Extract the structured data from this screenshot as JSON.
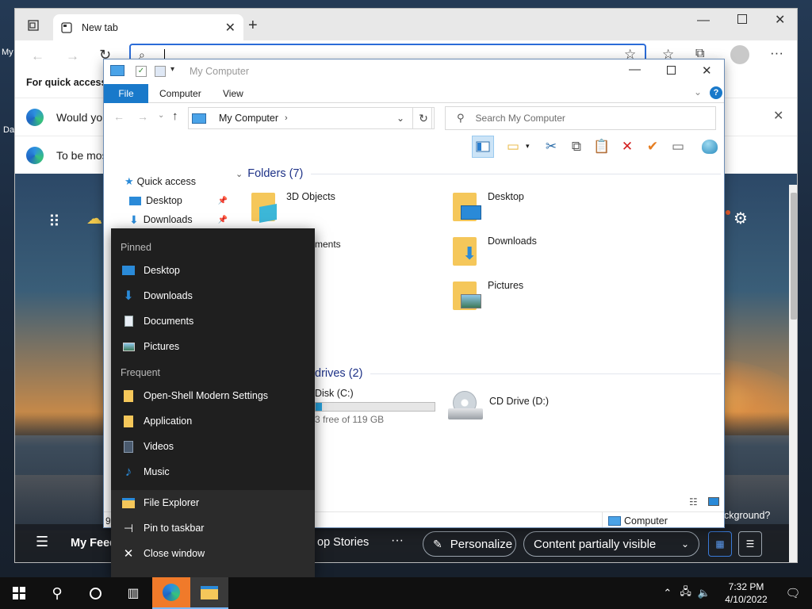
{
  "desktop": {
    "label_my": "My",
    "label_da": "Da"
  },
  "edge": {
    "tab_title": "New tab",
    "quick_access_prefix": "For quick access, p",
    "msg1": "Would you",
    "msg2": "To be mos",
    "news": {
      "my_feed": "My Feed",
      "top_stories": "op Stories",
      "more": "···",
      "personalize": "Personalize",
      "content_visibility": "Content partially visible",
      "background_q": "ckground?"
    }
  },
  "explorer": {
    "title": "My Computer",
    "tabs": {
      "file": "File",
      "computer": "Computer",
      "view": "View"
    },
    "breadcrumb": "My Computer",
    "search_placeholder": "Search My Computer",
    "nav": {
      "quick_access": "Quick access",
      "desktop": "Desktop",
      "downloads": "Downloads"
    },
    "folders_header": "Folders (7)",
    "folders": [
      "3D Objects",
      "Desktop",
      "Downloads",
      "Pictures"
    ],
    "partial_documents": "ments",
    "drives_header": "drives (2)",
    "drive_c": {
      "name": "Disk (C:)",
      "free": "3 free of 119 GB",
      "used_fraction": 0.05
    },
    "drive_d": {
      "name": "CD Drive (D:)"
    },
    "status_items": "9",
    "status_location": "Computer"
  },
  "jumplist": {
    "pinned_label": "Pinned",
    "pinned": [
      "Desktop",
      "Downloads",
      "Documents",
      "Pictures"
    ],
    "frequent_label": "Frequent",
    "frequent": [
      "Open-Shell Modern Settings",
      "Application",
      "Videos",
      "Music"
    ],
    "actions": [
      "File Explorer",
      "Pin to taskbar",
      "Close window"
    ]
  },
  "taskbar": {
    "time": "7:32 PM",
    "date": "4/10/2022"
  },
  "colors": {
    "accent": "#1979ca",
    "folder": "#f5c75a",
    "jump_bg": "#1f1f1f"
  }
}
